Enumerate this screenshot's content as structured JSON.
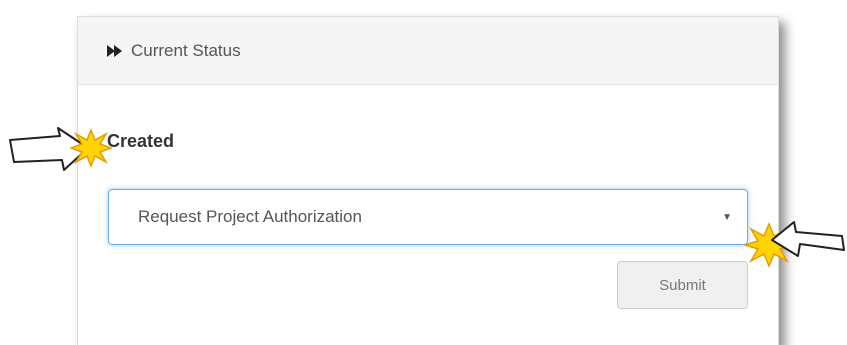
{
  "panel": {
    "header": {
      "icon": "fast-forward-icon",
      "title": "Current Status"
    },
    "status_label": "Created",
    "select": {
      "selected_value": "Request Project Authorization",
      "caret_icon": "caret-down-icon"
    },
    "submit_label": "Submit"
  },
  "annotations": {
    "left_arrow": "arrow-right-icon",
    "left_burst": "starburst-icon",
    "right_arrow": "arrow-left-icon",
    "right_burst": "starburst-icon",
    "burst_color": "#ffd400",
    "burst_outline": "#e89a00"
  },
  "colors": {
    "focus_border": "#66afe9",
    "header_bg": "#f5f5f5",
    "button_bg": "#f0f0f0"
  }
}
